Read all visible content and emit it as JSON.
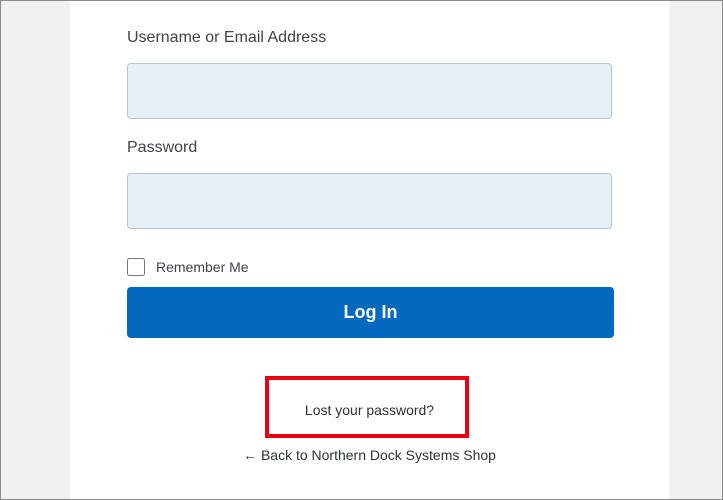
{
  "form": {
    "username_label": "Username or Email Address",
    "username_value": "",
    "password_label": "Password",
    "password_value": "",
    "remember_label": "Remember Me",
    "remember_checked": false,
    "login_button": "Log In"
  },
  "links": {
    "lost_password": "Lost your password?",
    "back_to_site": "← Back to Northern Dock Systems Shop"
  },
  "colors": {
    "primary_button": "#0468be",
    "input_background": "#e8f0f7",
    "highlight_box": "#e60012"
  }
}
